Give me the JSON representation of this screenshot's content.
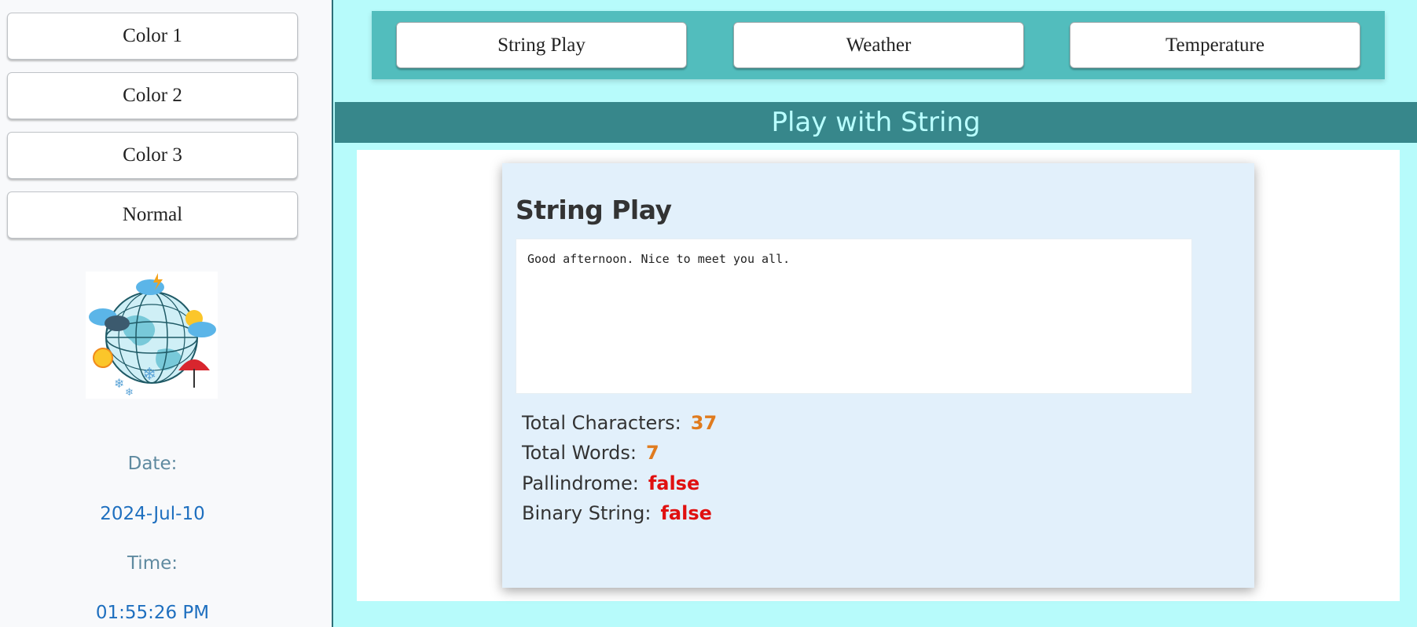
{
  "sidebar": {
    "buttons": [
      {
        "label": "Color 1"
      },
      {
        "label": "Color 2"
      },
      {
        "label": "Color 3"
      },
      {
        "label": "Normal"
      }
    ],
    "logo_icon": "weather-globe-icon",
    "date_label": "Date:",
    "date_value": "2024-Jul-10",
    "time_label": "Time:",
    "time_value": "01:55:26 PM"
  },
  "nav": {
    "tabs": [
      {
        "label": "String Play"
      },
      {
        "label": "Weather"
      },
      {
        "label": "Temperature"
      }
    ]
  },
  "page_title": "Play with String",
  "card": {
    "title": "String Play",
    "input_text": "Good afternoon. Nice to meet you all.",
    "stats": {
      "total_characters": {
        "label": "Total Characters:",
        "value": "37"
      },
      "total_words": {
        "label": "Total Words:",
        "value": "7"
      },
      "palindrome": {
        "label": "Pallindrome:",
        "value": "false"
      },
      "binary_string": {
        "label": "Binary String:",
        "value": "false"
      }
    }
  },
  "colors": {
    "background": "#b7fbfb",
    "nav_bar": "#52bdbd",
    "title_bar": "#37878b",
    "title_text": "#b9ffff",
    "card": "#e2f0fb",
    "number_value": "#e07b1e",
    "boolean_value": "#e01010"
  }
}
